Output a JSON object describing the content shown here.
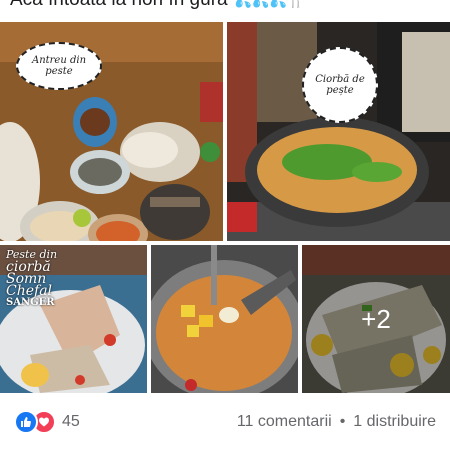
{
  "post": {
    "text": "Acă întoată la nori în gură",
    "emoji": "💦💦💦🍴"
  },
  "photos": {
    "p1_caption": "Antreu din peste",
    "p2_caption": "Ciorbă de pește",
    "p3_watermark": {
      "line1": "Peste din",
      "line2": "ciorbă",
      "line3": "Somn",
      "line4": "Chefal",
      "line5": "SANGER"
    },
    "p5_more": "+2"
  },
  "footer": {
    "reaction_count": "45",
    "comments": "11 comentarii",
    "separator": "•",
    "shares": "1 distribuire"
  },
  "colors": {
    "like": "#1877f2",
    "love": "#f33e58",
    "meta_text": "#65676b"
  }
}
